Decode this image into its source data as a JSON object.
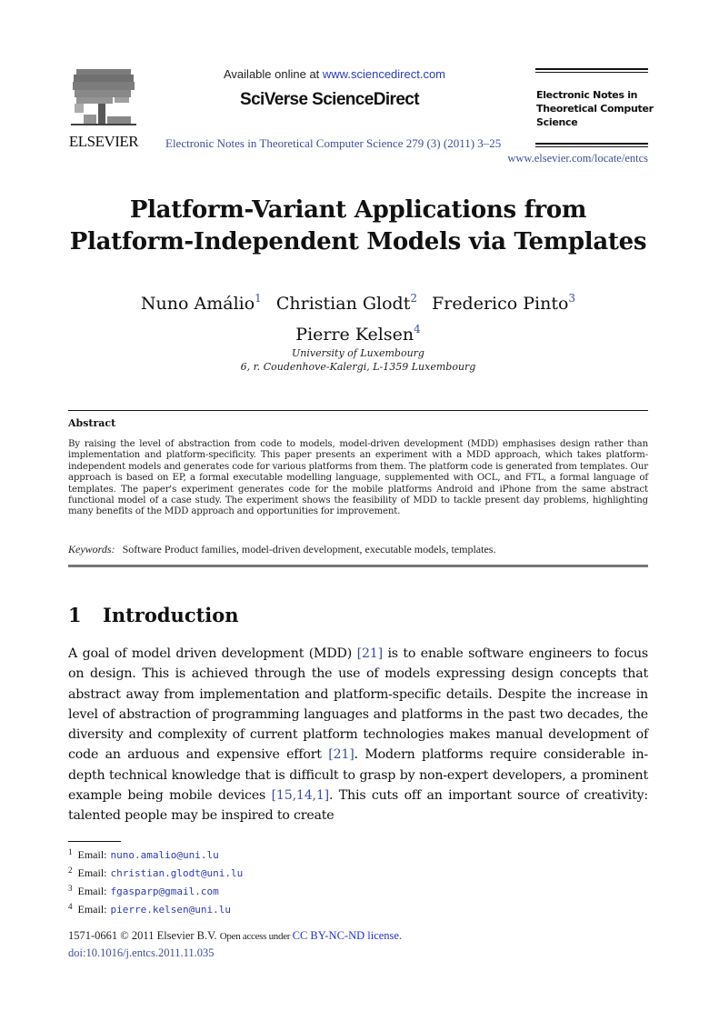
{
  "header": {
    "publisher_logo_text": "ELSEVIER",
    "available_online_prefix": "Available online at ",
    "available_online_url": "www.sciencedirect.com",
    "platform_name": "SciVerse ScienceDirect",
    "journal_citation": "Electronic Notes in Theoretical Computer Science 279 (3) (2011) 3–25",
    "journal_name_lines": [
      "Electronic Notes in",
      "Theoretical Computer",
      "Science"
    ],
    "journal_url": "www.elsevier.com/locate/entcs"
  },
  "paper": {
    "title_lines": [
      "Platform-Variant Applications from",
      "Platform-Independent Models via Templates"
    ],
    "authors": [
      {
        "name": "Nuno Amálio",
        "mark": "1"
      },
      {
        "name": "Christian Glodt",
        "mark": "2"
      },
      {
        "name": "Frederico Pinto",
        "mark": "3"
      },
      {
        "name": "Pierre Kelsen",
        "mark": "4"
      }
    ],
    "affiliation_lines": [
      "University of Luxembourg",
      "6, r.  Coudenhove-Kalergi, L-1359 Luxembourg"
    ]
  },
  "abstract": {
    "heading": "Abstract",
    "body": "By raising the level of abstraction from code to models, model-driven development (MDD) emphasises design rather than implementation and platform-specificity.  This paper presents an experiment with a MDD approach, which takes platform-independent models and generates code for various platforms from them. The platform code is generated from templates. Our approach is based on EP, a formal executable modelling language, supplemented with OCL, and FTL, a formal language of templates.  The paper's experiment generates code for the mobile platforms Android and iPhone from the same abstract functional model of a case study.  The experiment shows the feasibility of MDD to tackle present day problems, highlighting many benefits of the MDD approach and opportunities for improvement.",
    "keywords_label": "Keywords:",
    "keywords": "Software Product families, model-driven development, executable models, templates."
  },
  "section": {
    "number": "1",
    "title": "Introduction",
    "parts": [
      "A goal of model driven development (MDD) ",
      "[21]",
      " is to enable software engineers to focus on design.  This is achieved through the use of models expressing design concepts that abstract away from implementation and platform-specific details. Despite the increase in level of abstraction of programming languages and platforms in the past two decades, the diversity and complexity of current platform technologies makes manual development of code an arduous and expensive effort ",
      "[21]",
      ".  Modern platforms require considerable in-depth technical knowledge that is difficult to grasp by non-expert developers, a prominent example being mobile devices ",
      "[15,14,1]",
      ".  This cuts off an important source of creativity:  talented people may be inspired to create"
    ]
  },
  "footnotes": [
    {
      "mark": "1",
      "label": "Email:",
      "email": "nuno.amalio@uni.lu"
    },
    {
      "mark": "2",
      "label": "Email:",
      "email": "christian.glodt@uni.lu"
    },
    {
      "mark": "3",
      "label": "Email:",
      "email": "fgasparp@gmail.com"
    },
    {
      "mark": "4",
      "label": "Email:",
      "email": "pierre.kelsen@uni.lu"
    }
  ],
  "footer": {
    "copyright": "1571-0661 © 2011 Elsevier B.V. ",
    "open_access": "Open access under ",
    "license": "CC BY-NC-ND license.",
    "doi": "doi:10.1016/j.entcs.2011.11.035"
  },
  "colors": {
    "link_blue": "#2b3bb5",
    "citation_blue": "#3c4f9b",
    "rule_gray": "#777777"
  }
}
